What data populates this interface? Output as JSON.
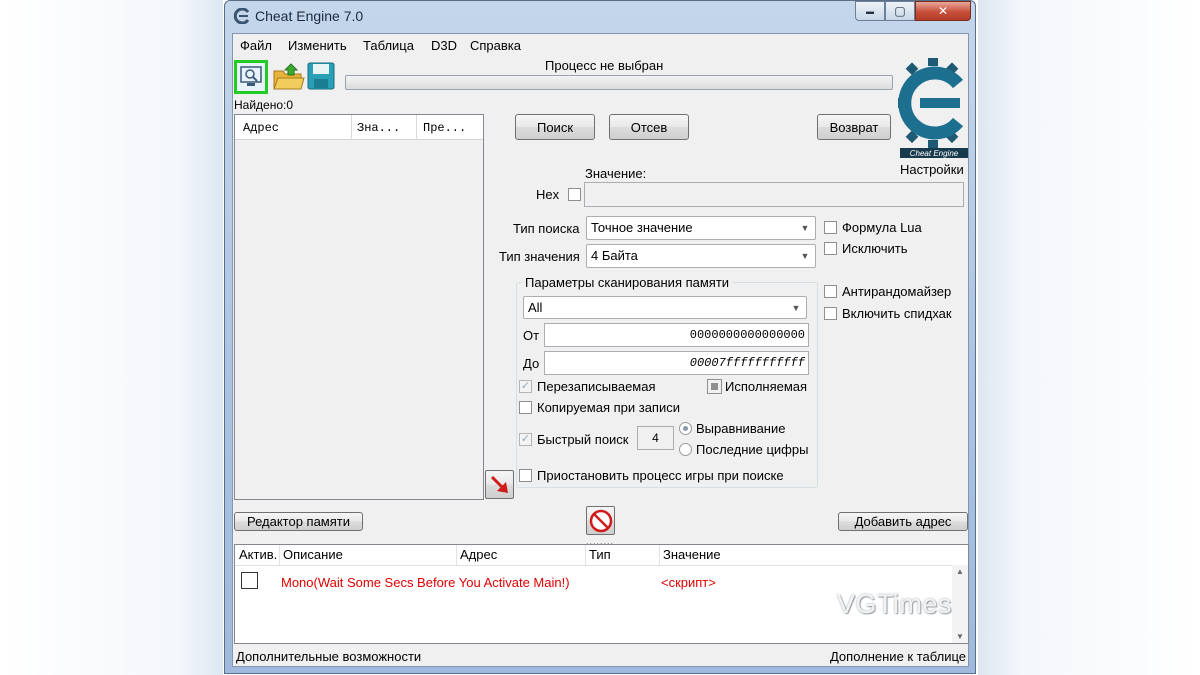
{
  "window": {
    "title": "Cheat Engine 7.0",
    "controls": {
      "minimize": "▬",
      "maximize": "▢",
      "close": "✕"
    }
  },
  "menu": [
    "Файл",
    "Изменить",
    "Таблица",
    "D3D",
    "Справка"
  ],
  "process_label": "Процесс не выбран",
  "settings_label": "Настройки",
  "found_label": "Найдено:0",
  "address_list": {
    "columns": [
      "Адрес",
      "Зна...",
      "Пре..."
    ]
  },
  "buttons": {
    "search": "Поиск",
    "filter": "Отсев",
    "undo": "Возврат",
    "memory_view": "Редактор памяти",
    "add_address": "Добавить адрес"
  },
  "scan": {
    "value_label": "Значение:",
    "hex_label": "Hex",
    "scan_type_label": "Тип поиска",
    "scan_type_value": "Точное значение",
    "value_type_label": "Тип значения",
    "value_type_value": "4 Байта"
  },
  "options": {
    "lua_formula": "Формула Lua",
    "not": "Исключить",
    "unrandomizer": "Антирандомайзер",
    "speedhack": "Включить спидхак"
  },
  "memory_scan": {
    "title": "Параметры сканирования памяти",
    "region_value": "All",
    "from_label": "От",
    "from_value": "0000000000000000",
    "to_label": "До",
    "to_value": "00007fffffffffff",
    "writable": "Перезаписываемая",
    "executable": "Исполняемая",
    "copy_on_write": "Копируемая при записи",
    "fast_scan": "Быстрый поиск",
    "fast_scan_value": "4",
    "alignment": "Выравнивание",
    "last_digits": "Последние цифры",
    "pause_game": "Приостановить процесс игры при поиске"
  },
  "cheat_table": {
    "columns": [
      "Актив.",
      "Описание",
      "Адрес",
      "Тип",
      "Значение"
    ],
    "rows": [
      {
        "description": "Mono(Wait Some Secs Before You Activate Main!)",
        "value": "<скрипт>"
      }
    ]
  },
  "statusbar": {
    "left": "Дополнительные возможности",
    "right": "Дополнение к таблице"
  },
  "watermark": "VGTimes",
  "logo_text": "Cheat Engine",
  "colors": {
    "accent_green": "#22cc22",
    "script_red": "#e00000",
    "logo_blue": "#1d6f8f"
  },
  "icons": [
    "cheat-engine-icon",
    "computer-icon",
    "open-folder-icon",
    "save-disk-icon",
    "red-arrow-icon",
    "stop-icon"
  ]
}
